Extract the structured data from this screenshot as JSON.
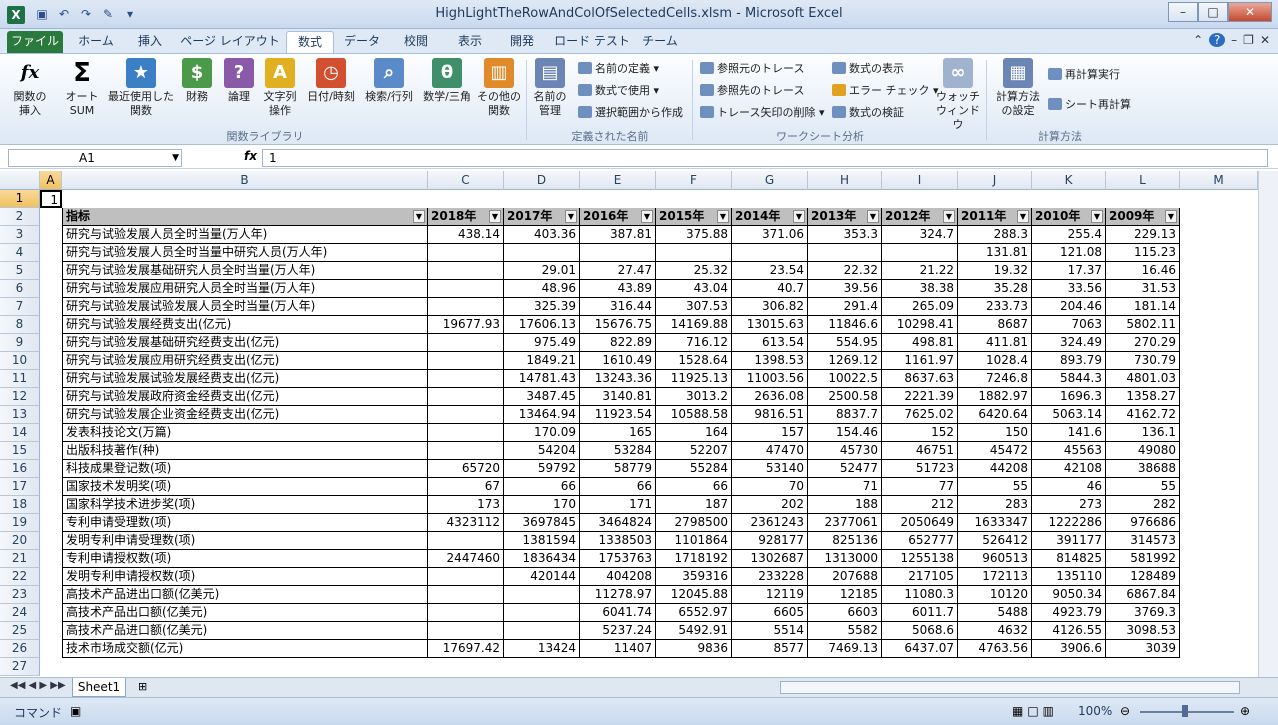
{
  "window": {
    "title": "HighLightTheRowAndColOfSelectedCells.xlsm - Microsoft Excel"
  },
  "tabs": [
    "ファイル",
    "ホーム",
    "挿入",
    "ページ レイアウト",
    "数式",
    "データ",
    "校閲",
    "表示",
    "開発",
    "ロード テスト",
    "チーム"
  ],
  "active_tab": "数式",
  "ribbon": {
    "insert_function": "関数の\n挿入",
    "autosum": "オート\nSUM",
    "recent": "最近使用した\n関数",
    "financial": "財務",
    "logical": "論理",
    "text": "文字列\n操作",
    "datetime": "日付/時刻",
    "lookup": "検索/行列",
    "math": "数学/三角",
    "more": "その他の\n関数",
    "group_library": "関数ライブラリ",
    "name_manager": "名前の\n管理",
    "define_name": "名前の定義",
    "use_in_formula": "数式で使用",
    "create_from_sel": "選択範囲から作成",
    "group_names": "定義された名前",
    "trace_precedents": "参照元のトレース",
    "trace_dependents": "参照先のトレース",
    "remove_arrows": "トレース矢印の削除",
    "show_formulas": "数式の表示",
    "error_check": "エラー チェック",
    "evaluate": "数式の検証",
    "watch": "ウォッチ\nウィンドウ",
    "group_audit": "ワークシート分析",
    "calc_options": "計算方法\nの設定",
    "calc_now": "再計算実行",
    "calc_sheet": "シート再計算",
    "group_calc": "計算方法"
  },
  "formula_bar": {
    "name_box": "A1",
    "fx": "fx",
    "value": "1"
  },
  "columns": [
    "A",
    "B",
    "C",
    "D",
    "E",
    "F",
    "G",
    "H",
    "I",
    "J",
    "K",
    "L",
    "M"
  ],
  "selected_col": "A",
  "selected_row": "1",
  "a1_value": "1",
  "table": {
    "headers": [
      "指标",
      "2018年",
      "2017年",
      "2016年",
      "2015年",
      "2014年",
      "2013年",
      "2012年",
      "2011年",
      "2010年",
      "2009年"
    ],
    "rows": [
      [
        "研究与试验发展人员全时当量(万人年)",
        "438.14",
        "403.36",
        "387.81",
        "375.88",
        "371.06",
        "353.3",
        "324.7",
        "288.3",
        "255.4",
        "229.13"
      ],
      [
        "研究与试验发展人员全时当量中研究人员(万人年)",
        "",
        "",
        "",
        "",
        "",
        "",
        "",
        "131.81",
        "121.08",
        "115.23"
      ],
      [
        "研究与试验发展基础研究人员全时当量(万人年)",
        "",
        "29.01",
        "27.47",
        "25.32",
        "23.54",
        "22.32",
        "21.22",
        "19.32",
        "17.37",
        "16.46"
      ],
      [
        "研究与试验发展应用研究人员全时当量(万人年)",
        "",
        "48.96",
        "43.89",
        "43.04",
        "40.7",
        "39.56",
        "38.38",
        "35.28",
        "33.56",
        "31.53"
      ],
      [
        "研究与试验发展试验发展人员全时当量(万人年)",
        "",
        "325.39",
        "316.44",
        "307.53",
        "306.82",
        "291.4",
        "265.09",
        "233.73",
        "204.46",
        "181.14"
      ],
      [
        "研究与试验发展经费支出(亿元)",
        "19677.93",
        "17606.13",
        "15676.75",
        "14169.88",
        "13015.63",
        "11846.6",
        "10298.41",
        "8687",
        "7063",
        "5802.11"
      ],
      [
        "研究与试验发展基础研究经费支出(亿元)",
        "",
        "975.49",
        "822.89",
        "716.12",
        "613.54",
        "554.95",
        "498.81",
        "411.81",
        "324.49",
        "270.29"
      ],
      [
        "研究与试验发展应用研究经费支出(亿元)",
        "",
        "1849.21",
        "1610.49",
        "1528.64",
        "1398.53",
        "1269.12",
        "1161.97",
        "1028.4",
        "893.79",
        "730.79"
      ],
      [
        "研究与试验发展试验发展经费支出(亿元)",
        "",
        "14781.43",
        "13243.36",
        "11925.13",
        "11003.56",
        "10022.5",
        "8637.63",
        "7246.8",
        "5844.3",
        "4801.03"
      ],
      [
        "研究与试验发展政府资金经费支出(亿元)",
        "",
        "3487.45",
        "3140.81",
        "3013.2",
        "2636.08",
        "2500.58",
        "2221.39",
        "1882.97",
        "1696.3",
        "1358.27"
      ],
      [
        "研究与试验发展企业资金经费支出(亿元)",
        "",
        "13464.94",
        "11923.54",
        "10588.58",
        "9816.51",
        "8837.7",
        "7625.02",
        "6420.64",
        "5063.14",
        "4162.72"
      ],
      [
        "发表科技论文(万篇)",
        "",
        "170.09",
        "165",
        "164",
        "157",
        "154.46",
        "152",
        "150",
        "141.6",
        "136.1"
      ],
      [
        "出版科技著作(种)",
        "",
        "54204",
        "53284",
        "52207",
        "47470",
        "45730",
        "46751",
        "45472",
        "45563",
        "49080"
      ],
      [
        "科技成果登记数(项)",
        "65720",
        "59792",
        "58779",
        "55284",
        "53140",
        "52477",
        "51723",
        "44208",
        "42108",
        "38688"
      ],
      [
        "国家技术发明奖(项)",
        "67",
        "66",
        "66",
        "66",
        "70",
        "71",
        "77",
        "55",
        "46",
        "55"
      ],
      [
        "国家科学技术进步奖(项)",
        "173",
        "170",
        "171",
        "187",
        "202",
        "188",
        "212",
        "283",
        "273",
        "282"
      ],
      [
        "专利申请受理数(项)",
        "4323112",
        "3697845",
        "3464824",
        "2798500",
        "2361243",
        "2377061",
        "2050649",
        "1633347",
        "1222286",
        "976686"
      ],
      [
        "发明专利申请受理数(项)",
        "",
        "1381594",
        "1338503",
        "1101864",
        "928177",
        "825136",
        "652777",
        "526412",
        "391177",
        "314573"
      ],
      [
        "专利申请授权数(项)",
        "2447460",
        "1836434",
        "1753763",
        "1718192",
        "1302687",
        "1313000",
        "1255138",
        "960513",
        "814825",
        "581992"
      ],
      [
        "发明专利申请授权数(项)",
        "",
        "420144",
        "404208",
        "359316",
        "233228",
        "207688",
        "217105",
        "172113",
        "135110",
        "128489"
      ],
      [
        "高技术产品进出口额(亿美元)",
        "",
        "",
        "11278.97",
        "12045.88",
        "12119",
        "12185",
        "11080.3",
        "10120",
        "9050.34",
        "6867.84"
      ],
      [
        "高技术产品出口额(亿美元)",
        "",
        "",
        "6041.74",
        "6552.97",
        "6605",
        "6603",
        "6011.7",
        "5488",
        "4923.79",
        "3769.3"
      ],
      [
        "高技术产品进口额(亿美元)",
        "",
        "",
        "5237.24",
        "5492.91",
        "5514",
        "5582",
        "5068.6",
        "4632",
        "4126.55",
        "3098.53"
      ],
      [
        "技术市场成交额(亿元)",
        "17697.42",
        "13424",
        "11407",
        "9836",
        "8577",
        "7469.13",
        "6437.07",
        "4763.56",
        "3906.6",
        "3039"
      ]
    ]
  },
  "row_numbers": [
    "1",
    "2",
    "3",
    "4",
    "5",
    "6",
    "7",
    "8",
    "9",
    "10",
    "11",
    "12",
    "13",
    "14",
    "15",
    "16",
    "17",
    "18",
    "19",
    "20",
    "21",
    "22",
    "23",
    "24",
    "25",
    "26",
    "27"
  ],
  "sheet_tab": "Sheet1",
  "status": {
    "mode": "コマンド",
    "zoom": "100%"
  }
}
